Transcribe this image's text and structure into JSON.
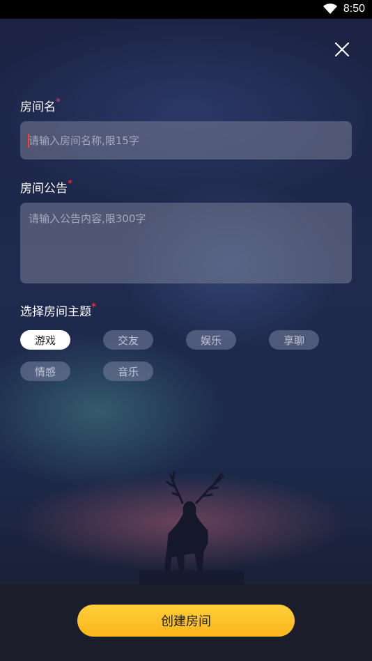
{
  "status_bar": {
    "time": "8:50"
  },
  "form": {
    "room_name": {
      "label": "房间名",
      "required_mark": "*",
      "placeholder": "请输入房间名称,限15字",
      "value": ""
    },
    "room_notice": {
      "label": "房间公告",
      "required_mark": "*",
      "placeholder": "请输入公告内容,限300字",
      "value": ""
    },
    "theme": {
      "label": "选择房间主题",
      "required_mark": "*",
      "options": [
        "游戏",
        "交友",
        "娱乐",
        "享聊",
        "情感",
        "音乐"
      ],
      "selected": "游戏"
    }
  },
  "create_button": {
    "label": "创建房间"
  },
  "colors": {
    "accent": "#fbb51a",
    "required": "#ff3b3b"
  },
  "icons": {
    "close": "close-icon",
    "wifi": "wifi-icon"
  }
}
